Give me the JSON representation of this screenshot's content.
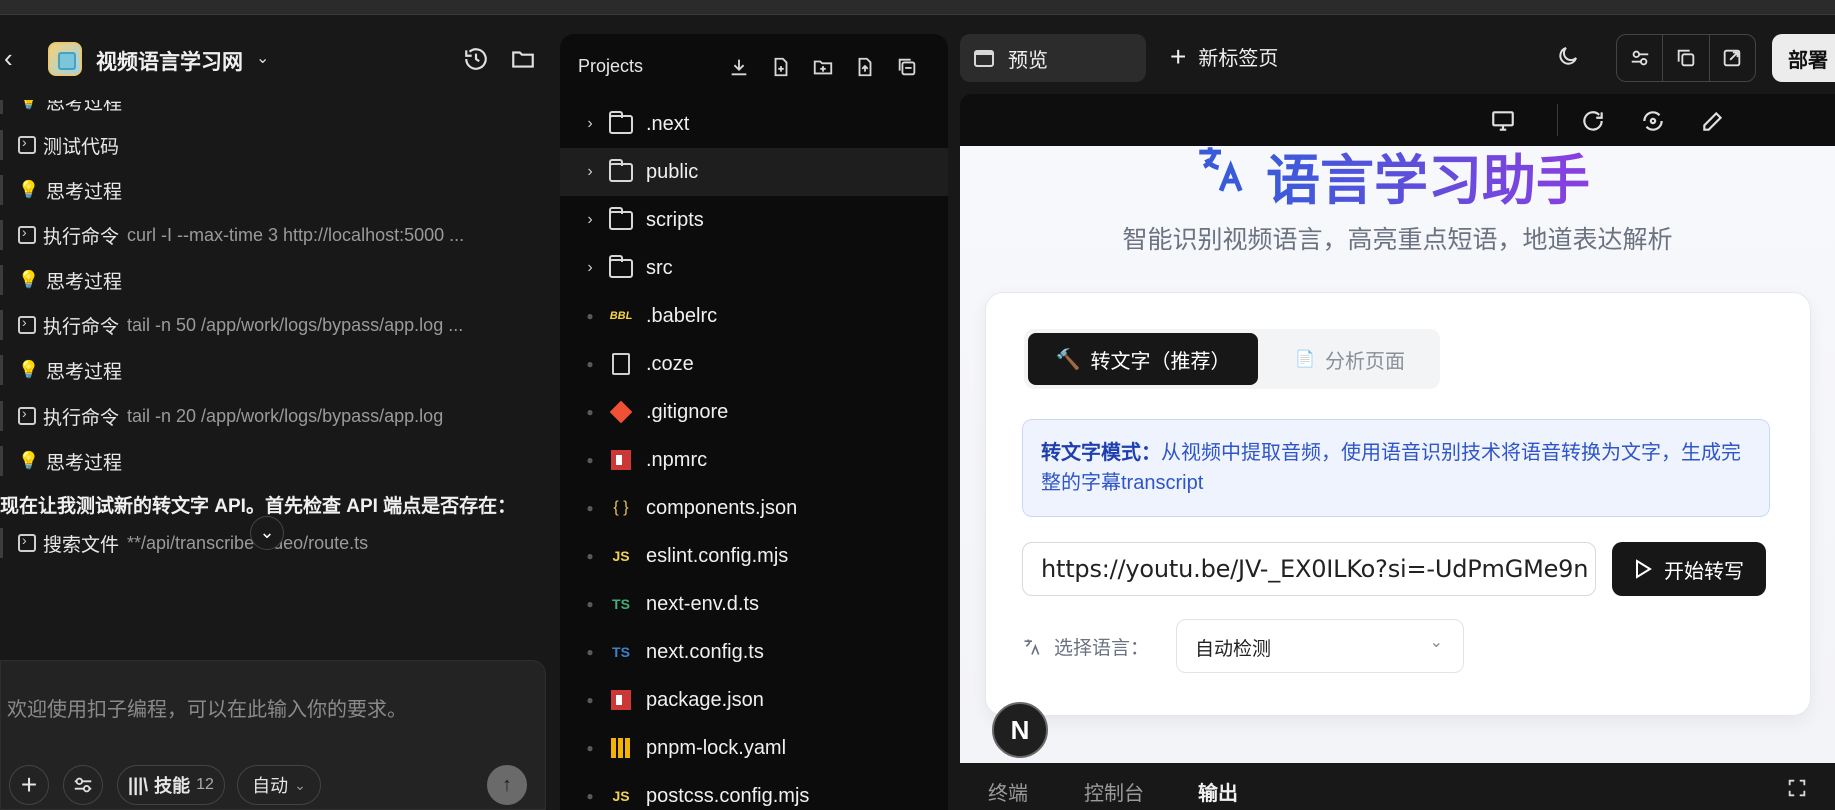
{
  "chat": {
    "app_title": "视频语言学习网",
    "messages": [
      {
        "kind": "think",
        "label": "思考过程",
        "cmd": ""
      },
      {
        "kind": "exec",
        "label": "测试代码",
        "cmd": ""
      },
      {
        "kind": "think",
        "label": "思考过程",
        "cmd": ""
      },
      {
        "kind": "exec",
        "label": "执行命令",
        "cmd": "curl -I --max-time 3 http://localhost:5000 ..."
      },
      {
        "kind": "think",
        "label": "思考过程",
        "cmd": ""
      },
      {
        "kind": "exec",
        "label": "执行命令",
        "cmd": "tail -n 50 /app/work/logs/bypass/app.log ..."
      },
      {
        "kind": "think",
        "label": "思考过程",
        "cmd": ""
      },
      {
        "kind": "exec",
        "label": "执行命令",
        "cmd": "tail -n 20 /app/work/logs/bypass/app.log"
      },
      {
        "kind": "think",
        "label": "思考过程",
        "cmd": ""
      },
      {
        "kind": "exec",
        "label": "搜索文件",
        "cmd": "**/api/transcribe-video/route.ts"
      }
    ],
    "plain_text": "现在让我测试新的转文字 API。首先检查 API 端点是否存在：",
    "composer_placeholder": "欢迎使用扣子编程，可以在此输入你的要求。",
    "skills_label": "技能",
    "skills_count": "12",
    "mode_label": "自动"
  },
  "tree": {
    "title": "Projects",
    "items": [
      {
        "name": ".next",
        "type": "folder",
        "selected": false
      },
      {
        "name": "public",
        "type": "folder",
        "selected": true
      },
      {
        "name": "scripts",
        "type": "folder",
        "selected": false
      },
      {
        "name": "src",
        "type": "folder",
        "selected": false
      },
      {
        "name": ".babelrc",
        "type": "babel",
        "selected": false
      },
      {
        "name": ".coze",
        "type": "file",
        "selected": false
      },
      {
        "name": ".gitignore",
        "type": "git",
        "selected": false
      },
      {
        "name": ".npmrc",
        "type": "npm",
        "selected": false
      },
      {
        "name": "components.json",
        "type": "json",
        "selected": false
      },
      {
        "name": "eslint.config.mjs",
        "type": "js",
        "selected": false
      },
      {
        "name": "next-env.d.ts",
        "type": "ts",
        "selected": false
      },
      {
        "name": "next.config.ts",
        "type": "ts",
        "selected": false
      },
      {
        "name": "package.json",
        "type": "npm",
        "selected": false
      },
      {
        "name": "pnpm-lock.yaml",
        "type": "lock",
        "selected": false
      },
      {
        "name": "postcss.config.mjs",
        "type": "js",
        "selected": false
      }
    ]
  },
  "browser": {
    "tab_preview": "预览",
    "tab_new": "新标签页",
    "deploy_label": "部署",
    "bottom_tabs": [
      "终端",
      "控制台",
      "输出"
    ],
    "active_bottom_tab": "输出"
  },
  "page": {
    "title": "语言学习助手",
    "subtitle": "智能识别视频语言，高亮重点短语，地道表达解析",
    "tab_transcribe": "转文字（推荐）",
    "tab_analyze": "分析页面",
    "info_bold": "转文字模式：",
    "info_text": "从视频中提取音频，使用语音识别技术将语音转换为文字，生成完整的字幕transcript",
    "url_value": "https://youtu.be/JV-_EX0ILKo?si=-UdPmGMe9n",
    "start_button": "开始转写",
    "lang_label": "选择语言：",
    "lang_value": "自动检测",
    "badge": "N"
  },
  "colors": {
    "accent_from": "#3a5bd9",
    "accent_to": "#8a3fe0",
    "info_text": "#2f55c8",
    "dark_button": "#171717"
  }
}
